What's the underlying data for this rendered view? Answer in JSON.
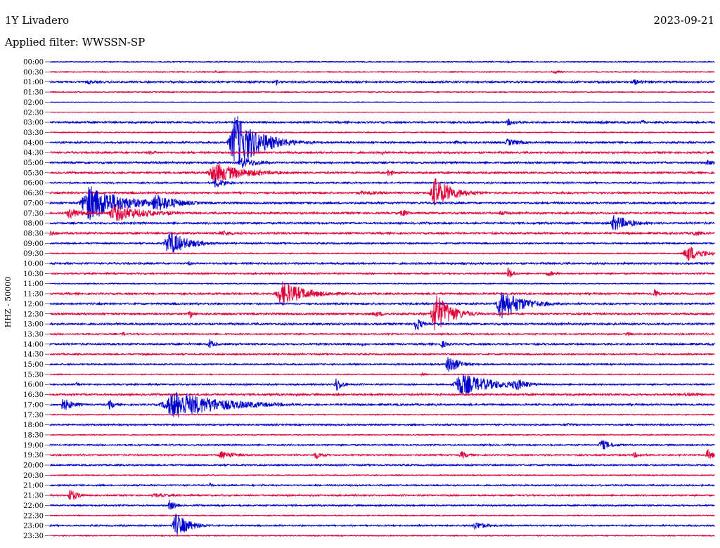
{
  "header": {
    "station": "1Y Livadero",
    "date": "2023-09-21",
    "filter": "Applied filter: WWSSN-SP"
  },
  "axis_label": "HHZ - 50000",
  "colors": {
    "blue": "#0000cc",
    "red": "#e0003a"
  },
  "chart_data": {
    "type": "line",
    "title": "1Y Livadero",
    "subtitle": "Applied filter: WWSSN-SP",
    "ylabel": "HHZ - 50000",
    "row_labels": [
      "00:00",
      "00:30",
      "01:00",
      "01:30",
      "02:00",
      "02:30",
      "03:00",
      "03:30",
      "04:00",
      "04:30",
      "05:00",
      "05:30",
      "06:00",
      "06:30",
      "07:00",
      "07:30",
      "08:00",
      "08:30",
      "09:00",
      "09:30",
      "10:00",
      "10:30",
      "11:00",
      "11:30",
      "12:00",
      "12:30",
      "13:00",
      "13:30",
      "14:00",
      "14:30",
      "15:00",
      "15:30",
      "16:00",
      "16:30",
      "17:00",
      "17:30",
      "18:00",
      "18:30",
      "19:00",
      "19:30",
      "20:00",
      "20:30",
      "21:00",
      "21:30",
      "22:00",
      "22:30",
      "23:00",
      "23:30"
    ],
    "row_colors": [
      "blue",
      "red"
    ],
    "baseline_noise": [
      1,
      1,
      2,
      1,
      0.5,
      0.5,
      2,
      1,
      2,
      2,
      2,
      2,
      1.5,
      2,
      2,
      2,
      2,
      2,
      1.5,
      1,
      2,
      1.5,
      1,
      2,
      2,
      2,
      2,
      1.5,
      2,
      1.5,
      1.5,
      1,
      1.5,
      2,
      2,
      1,
      1.5,
      1,
      1.5,
      1.5,
      1.5,
      1,
      1.5,
      1.5,
      1.5,
      1,
      1.5,
      1
    ],
    "events": [
      {
        "row": 0,
        "x": 0.69,
        "amp": 1,
        "width": 0.03
      },
      {
        "row": 1,
        "x": 0.76,
        "amp": 3,
        "width": 0.012
      },
      {
        "row": 1,
        "x": 0.25,
        "amp": 2,
        "width": 0.02
      },
      {
        "row": 2,
        "x": 0.34,
        "amp": 5,
        "width": 0.006
      },
      {
        "row": 2,
        "x": 0.88,
        "amp": 4,
        "width": 0.02
      },
      {
        "row": 2,
        "x": 0.06,
        "amp": 3,
        "width": 0.03
      },
      {
        "row": 6,
        "x": 0.69,
        "amp": 5,
        "width": 0.02
      },
      {
        "row": 6,
        "x": 0.83,
        "amp": 4,
        "width": 0.01
      },
      {
        "row": 6,
        "x": 0.89,
        "amp": 4,
        "width": 0.01
      },
      {
        "row": 8,
        "x": 0.28,
        "amp": 40,
        "width": 0.045
      },
      {
        "row": 8,
        "x": 0.69,
        "amp": 5,
        "width": 0.03
      },
      {
        "row": 8,
        "x": 0.61,
        "amp": 3,
        "width": 0.01
      },
      {
        "row": 9,
        "x": 0.5,
        "amp": 4,
        "width": 0.005
      },
      {
        "row": 9,
        "x": 0.15,
        "amp": 3,
        "width": 0.02
      },
      {
        "row": 10,
        "x": 0.29,
        "amp": 8,
        "width": 0.035
      },
      {
        "row": 10,
        "x": 0.99,
        "amp": 4,
        "width": 0.02
      },
      {
        "row": 11,
        "x": 0.25,
        "amp": 14,
        "width": 0.06
      },
      {
        "row": 11,
        "x": 0.51,
        "amp": 6,
        "width": 0.01
      },
      {
        "row": 12,
        "x": 0.25,
        "amp": 8,
        "width": 0.02
      },
      {
        "row": 13,
        "x": 0.58,
        "amp": 22,
        "width": 0.035
      },
      {
        "row": 13,
        "x": 0.47,
        "amp": 3,
        "width": 0.06
      },
      {
        "row": 14,
        "x": 0.06,
        "amp": 26,
        "width": 0.06
      },
      {
        "row": 14,
        "x": 0.16,
        "amp": 14,
        "width": 0.04
      },
      {
        "row": 15,
        "x": 0.03,
        "amp": 8,
        "width": 0.03
      },
      {
        "row": 15,
        "x": 0.1,
        "amp": 12,
        "width": 0.06
      },
      {
        "row": 15,
        "x": 0.53,
        "amp": 6,
        "width": 0.015
      },
      {
        "row": 15,
        "x": 0.68,
        "amp": 4,
        "width": 0.02
      },
      {
        "row": 16,
        "x": 0.85,
        "amp": 12,
        "width": 0.03
      },
      {
        "row": 17,
        "x": 0.26,
        "amp": 4,
        "width": 0.03
      },
      {
        "row": 17,
        "x": 0.0,
        "amp": 4,
        "width": 0.02
      },
      {
        "row": 17,
        "x": 0.97,
        "amp": 4,
        "width": 0.02
      },
      {
        "row": 18,
        "x": 0.18,
        "amp": 18,
        "width": 0.035
      },
      {
        "row": 19,
        "x": 0.96,
        "amp": 12,
        "width": 0.03
      },
      {
        "row": 20,
        "x": 0.21,
        "amp": 4,
        "width": 0.006
      },
      {
        "row": 20,
        "x": 0.62,
        "amp": 4,
        "width": 0.006
      },
      {
        "row": 21,
        "x": 0.69,
        "amp": 10,
        "width": 0.008
      },
      {
        "row": 21,
        "x": 0.75,
        "amp": 4,
        "width": 0.02
      },
      {
        "row": 23,
        "x": 0.35,
        "amp": 18,
        "width": 0.045
      },
      {
        "row": 23,
        "x": 0.91,
        "amp": 10,
        "width": 0.006
      },
      {
        "row": 24,
        "x": 0.68,
        "amp": 22,
        "width": 0.04
      },
      {
        "row": 25,
        "x": 0.21,
        "amp": 8,
        "width": 0.008
      },
      {
        "row": 25,
        "x": 0.49,
        "amp": 4,
        "width": 0.03
      },
      {
        "row": 25,
        "x": 0.58,
        "amp": 30,
        "width": 0.03
      },
      {
        "row": 26,
        "x": 0.55,
        "amp": 12,
        "width": 0.012
      },
      {
        "row": 27,
        "x": 0.11,
        "amp": 3,
        "width": 0.01
      },
      {
        "row": 27,
        "x": 0.87,
        "amp": 3,
        "width": 0.01
      },
      {
        "row": 28,
        "x": 0.24,
        "amp": 8,
        "width": 0.01
      },
      {
        "row": 28,
        "x": 0.59,
        "amp": 6,
        "width": 0.012
      },
      {
        "row": 28,
        "x": 0.47,
        "amp": 3,
        "width": 0.01
      },
      {
        "row": 29,
        "x": 0.14,
        "amp": 3,
        "width": 0.01
      },
      {
        "row": 30,
        "x": 0.6,
        "amp": 14,
        "width": 0.02
      },
      {
        "row": 31,
        "x": 0.56,
        "amp": 3,
        "width": 0.01
      },
      {
        "row": 32,
        "x": 0.43,
        "amp": 12,
        "width": 0.012
      },
      {
        "row": 32,
        "x": 0.62,
        "amp": 16,
        "width": 0.06
      },
      {
        "row": 32,
        "x": 0.7,
        "amp": 10,
        "width": 0.025
      },
      {
        "row": 32,
        "x": 0.04,
        "amp": 3,
        "width": 0.006
      },
      {
        "row": 33,
        "x": 0.96,
        "amp": 3,
        "width": 0.04
      },
      {
        "row": 34,
        "x": 0.02,
        "amp": 10,
        "width": 0.02
      },
      {
        "row": 34,
        "x": 0.19,
        "amp": 20,
        "width": 0.09
      },
      {
        "row": 34,
        "x": 0.09,
        "amp": 8,
        "width": 0.01
      },
      {
        "row": 36,
        "x": 0.78,
        "amp": 3,
        "width": 0.02
      },
      {
        "row": 38,
        "x": 0.83,
        "amp": 8,
        "width": 0.02
      },
      {
        "row": 39,
        "x": 0.26,
        "amp": 6,
        "width": 0.03
      },
      {
        "row": 39,
        "x": 0.4,
        "amp": 6,
        "width": 0.015
      },
      {
        "row": 39,
        "x": 0.62,
        "amp": 5,
        "width": 0.02
      },
      {
        "row": 39,
        "x": 0.88,
        "amp": 4,
        "width": 0.02
      },
      {
        "row": 39,
        "x": 0.99,
        "amp": 8,
        "width": 0.015
      },
      {
        "row": 42,
        "x": 0.24,
        "amp": 4,
        "width": 0.005
      },
      {
        "row": 43,
        "x": 0.03,
        "amp": 10,
        "width": 0.015
      },
      {
        "row": 43,
        "x": 0.16,
        "amp": 3,
        "width": 0.04
      },
      {
        "row": 44,
        "x": 0.18,
        "amp": 8,
        "width": 0.012
      },
      {
        "row": 46,
        "x": 0.19,
        "amp": 18,
        "width": 0.025
      },
      {
        "row": 46,
        "x": 0.64,
        "amp": 6,
        "width": 0.025
      }
    ]
  }
}
